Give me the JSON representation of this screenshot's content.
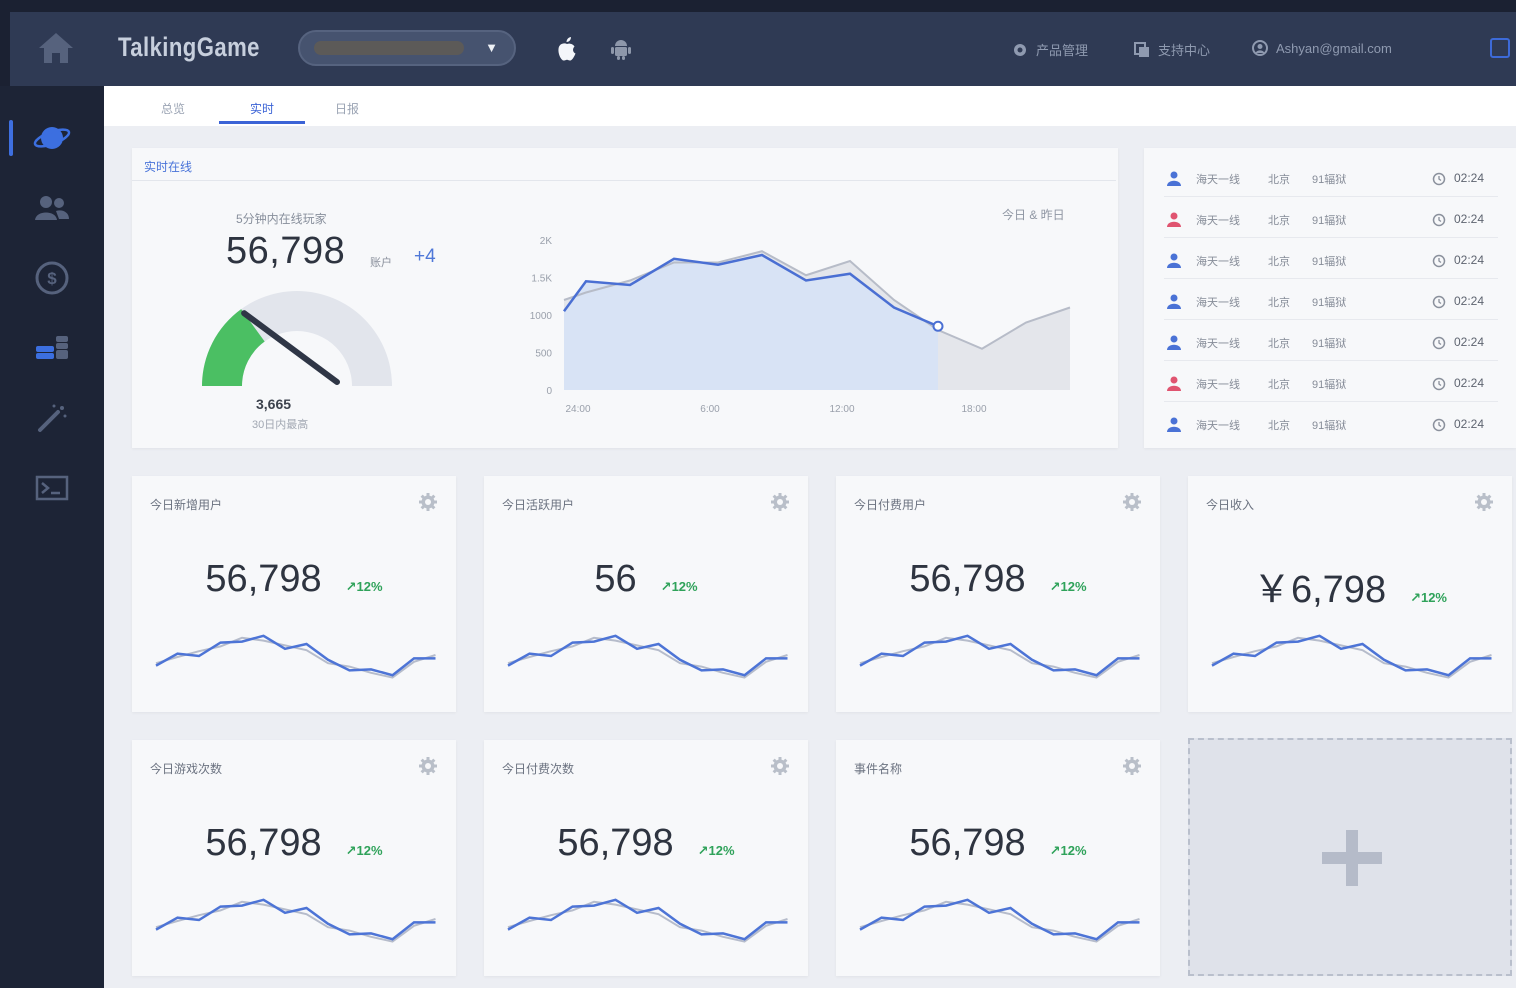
{
  "header": {
    "brand": "TalkingGame",
    "links": [
      {
        "label": "产品管理"
      },
      {
        "label": "支持中心"
      },
      {
        "label": "Ashyan@gmail.com"
      }
    ]
  },
  "tabs": [
    {
      "label": "总览"
    },
    {
      "label": "实时"
    },
    {
      "label": "日报"
    }
  ],
  "realtime": {
    "title": "实时在线",
    "gauge_label": "5分钟内在线玩家",
    "online_value": "56,798",
    "online_unit": "账户",
    "online_delta": "+4",
    "gauge_fill_fraction": 0.3,
    "max_value": "3,665",
    "max_label": "30日内最高",
    "legend": "今日 & 昨日"
  },
  "chart_data": {
    "type": "area",
    "x_ticks": [
      "24:00",
      "6:00",
      "12:00",
      "18:00"
    ],
    "y_ticks": [
      "0",
      "500",
      "1000",
      "1.5K",
      "2K"
    ],
    "ylim": [
      0,
      2000
    ],
    "xlim": [
      0,
      24
    ],
    "series": [
      {
        "x": [
          0,
          1,
          3,
          5,
          7,
          9,
          11,
          13,
          15,
          17
        ],
        "values": [
          1050,
          1450,
          1400,
          1750,
          1670,
          1800,
          1460,
          1550,
          1100,
          850
        ]
      },
      {
        "x": [
          0,
          1,
          3,
          5,
          7,
          9,
          11,
          13,
          15,
          17,
          19,
          21,
          23
        ],
        "values": [
          1200,
          1300,
          1460,
          1700,
          1700,
          1850,
          1530,
          1720,
          1200,
          800,
          550,
          900,
          1100
        ]
      }
    ]
  },
  "visitors": [
    {
      "name": "海天一线",
      "city": "北京",
      "server": "91辐狱",
      "time": "02:24",
      "color": "#4a72d6"
    },
    {
      "name": "海天一线",
      "city": "北京",
      "server": "91辐狱",
      "time": "02:24",
      "color": "#e05470"
    },
    {
      "name": "海天一线",
      "city": "北京",
      "server": "91辐狱",
      "time": "02:24",
      "color": "#4a72d6"
    },
    {
      "name": "海天一线",
      "city": "北京",
      "server": "91辐狱",
      "time": "02:24",
      "color": "#4a72d6"
    },
    {
      "name": "海天一线",
      "city": "北京",
      "server": "91辐狱",
      "time": "02:24",
      "color": "#4a72d6"
    },
    {
      "name": "海天一线",
      "city": "北京",
      "server": "91辐狱",
      "time": "02:24",
      "color": "#e05470"
    },
    {
      "name": "海天一线",
      "city": "北京",
      "server": "91辐狱",
      "time": "02:24",
      "color": "#4a72d6"
    }
  ],
  "metrics": [
    {
      "title": "今日新增用户",
      "value": "56,798",
      "change": "↗12%"
    },
    {
      "title": "今日活跃用户",
      "value": "56",
      "change": "↗12%"
    },
    {
      "title": "今日付费用户",
      "value": "56,798",
      "change": "↗12%"
    },
    {
      "title": "今日收入",
      "value": "￥6,798",
      "change": "↗12%"
    },
    {
      "title": "今日游戏次数",
      "value": "56,798",
      "change": "↗12%"
    },
    {
      "title": "今日付费次数",
      "value": "56,798",
      "change": "↗12%"
    },
    {
      "title": "事件名称",
      "value": "56,798",
      "change": "↗12%"
    }
  ],
  "colors": {
    "accent": "#3b63d6",
    "up": "#2fa25a",
    "gauge_fill": "#4bbf63"
  }
}
